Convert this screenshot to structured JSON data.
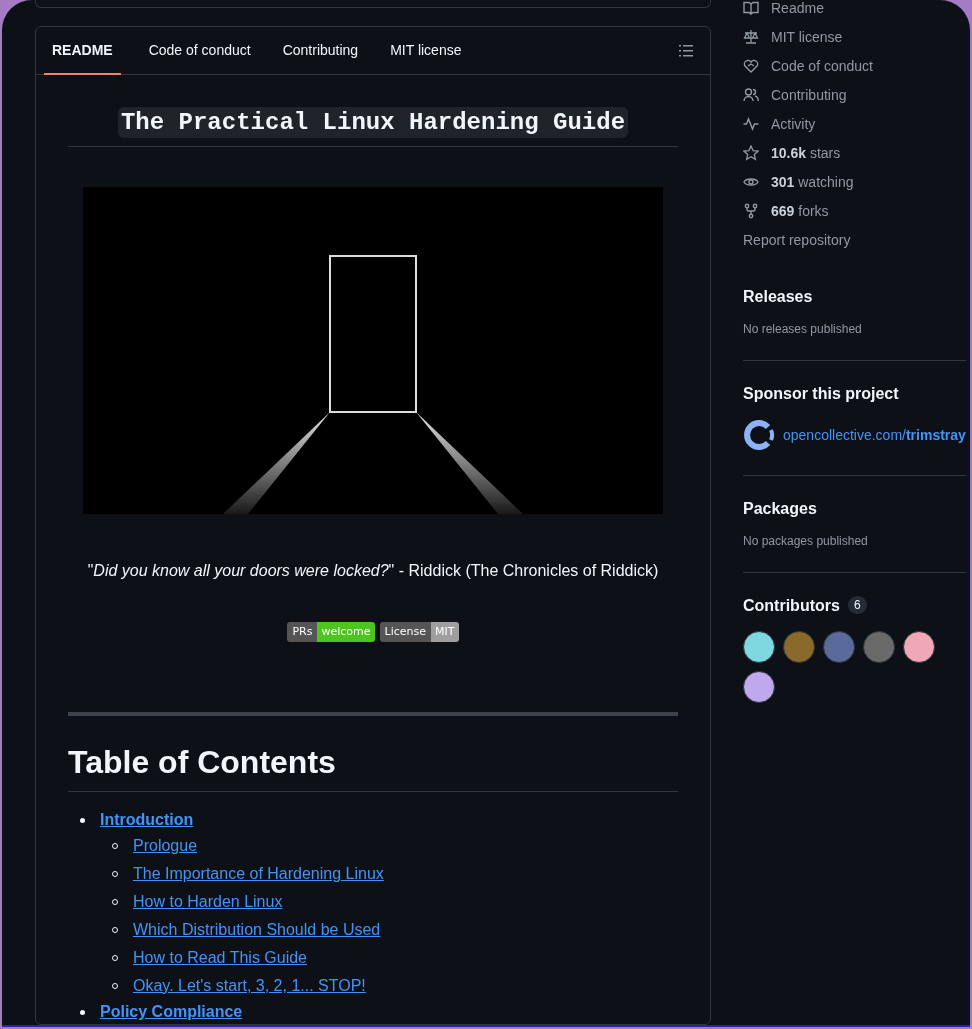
{
  "readme": {
    "tabs": [
      {
        "label": "README",
        "selected": true
      },
      {
        "label": "Code of conduct",
        "selected": false
      },
      {
        "label": "Contributing",
        "selected": false
      },
      {
        "label": "MIT license",
        "selected": false
      }
    ],
    "title": "The Practical Linux Hardening Guide",
    "quote": "\"*Did you know all your doors were locked?*\" - Riddick (The Chronicles of Riddick)",
    "badges": [
      {
        "label": "PRs",
        "value": "welcome",
        "color": "#4cc61e"
      },
      {
        "label": "License",
        "value": "MIT",
        "color": "#9f9f9f"
      }
    ],
    "toc_heading": "Table of Contents",
    "toc": [
      {
        "label": "Introduction",
        "children": [
          {
            "label": "Prologue"
          },
          {
            "label": "The Importance of Hardening Linux"
          },
          {
            "label": "How to Harden Linux"
          },
          {
            "label": "Which Distribution Should be Used"
          },
          {
            "label": "How to Read This Guide"
          },
          {
            "label": "Okay. Let's start, 3, 2, 1... STOP!"
          }
        ]
      },
      {
        "label": "Policy Compliance"
      }
    ]
  },
  "sidebar": {
    "links": [
      {
        "kind": "book",
        "text": "Readme"
      },
      {
        "kind": "scale",
        "text": "MIT license"
      },
      {
        "kind": "heart",
        "text": "Code of conduct"
      },
      {
        "kind": "people",
        "text": "Contributing"
      },
      {
        "kind": "pulse",
        "text": "Activity"
      },
      {
        "kind": "star",
        "count": "10.6k",
        "text": "stars"
      },
      {
        "kind": "eye",
        "count": "301",
        "text": "watching"
      },
      {
        "kind": "fork",
        "count": "669",
        "text": "forks"
      },
      {
        "kind": "plain",
        "text": "Report repository"
      }
    ],
    "releases": {
      "title": "Releases",
      "note": "No releases published"
    },
    "sponsor": {
      "title": "Sponsor this project",
      "link_prefix": "opencollective.com/",
      "link_bold": "trimstray"
    },
    "packages": {
      "title": "Packages",
      "note": "No packages published"
    },
    "contributors": {
      "title": "Contributors",
      "count": "6",
      "avatars": [
        {
          "color": "#7fd8e0"
        },
        {
          "color": "#8a6a2a"
        },
        {
          "color": "#5a6a9a"
        },
        {
          "color": "#6a6a6a"
        },
        {
          "color": "#f0a8b8"
        },
        {
          "color": "#c0a8ee"
        }
      ]
    }
  }
}
